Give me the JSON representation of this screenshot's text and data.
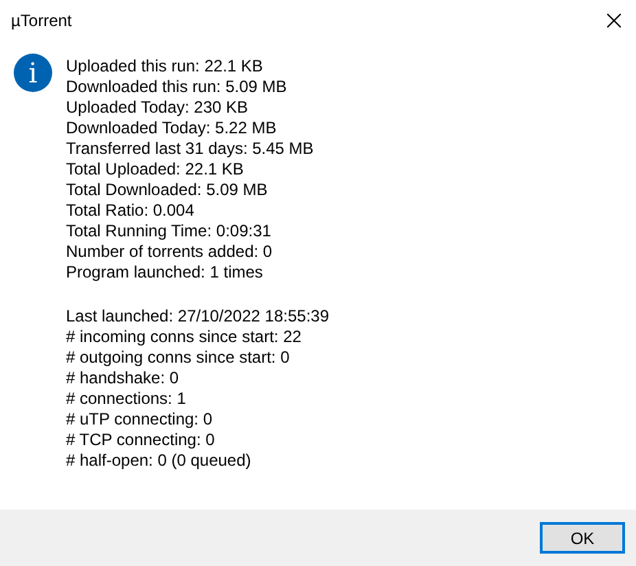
{
  "window": {
    "title": "µTorrent"
  },
  "sections": [
    [
      "Uploaded this run: 22.1 KB",
      "Downloaded this run: 5.09 MB",
      "Uploaded Today: 230 KB",
      "Downloaded Today: 5.22 MB",
      "Transferred last 31 days: 5.45 MB",
      "Total Uploaded: 22.1 KB",
      "Total Downloaded: 5.09 MB",
      "Total Ratio: 0.004",
      "Total Running Time: 0:09:31",
      "Number of torrents added: 0",
      "Program launched: 1 times"
    ],
    [
      "Last launched: 27/10/2022 18:55:39",
      "# incoming conns since start: 22",
      "# outgoing conns since start: 0",
      "# handshake: 0",
      "# connections: 1",
      "# uTP connecting: 0",
      "# TCP connecting: 0",
      "# half-open: 0 (0 queued)"
    ]
  ],
  "icon": {
    "symbol": "i"
  },
  "buttons": [
    "OK"
  ]
}
